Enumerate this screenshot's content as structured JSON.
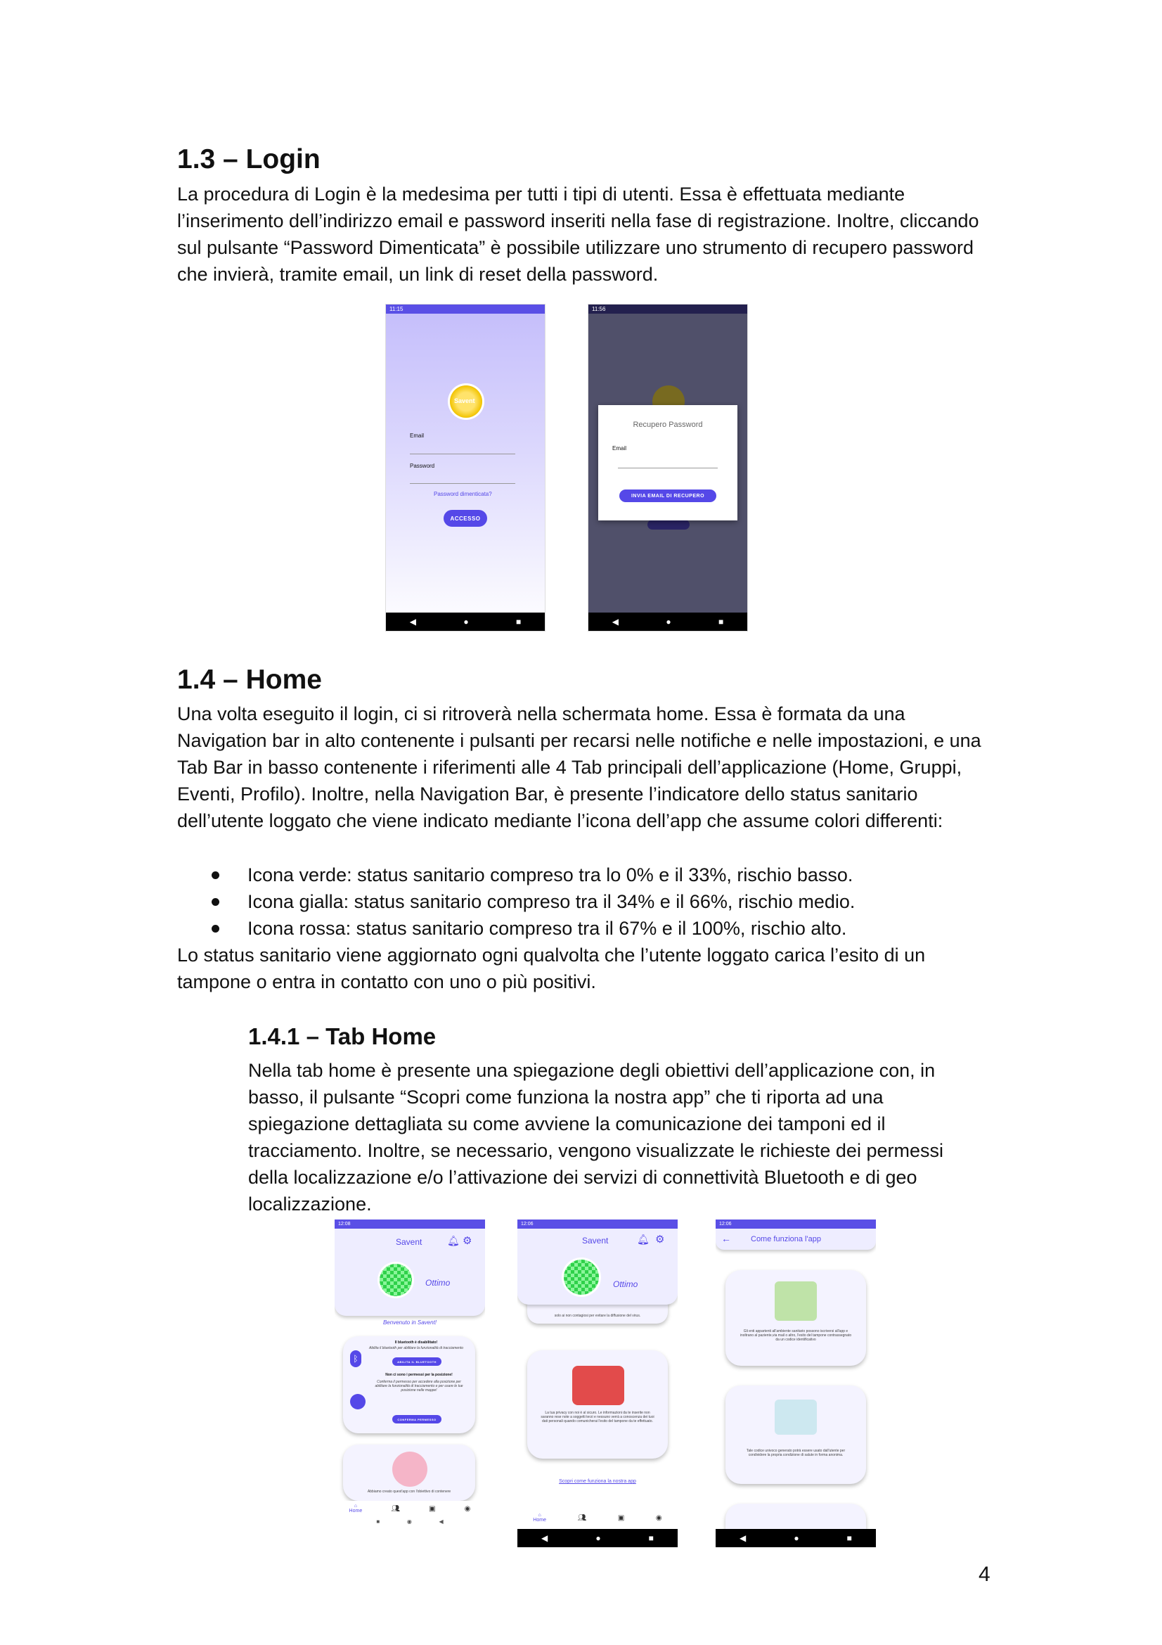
{
  "sec13": {
    "title": "1.3 – Login",
    "text": "La procedura di Login è la medesima per tutti i tipi di utenti. Essa è effettuata mediante l’inserimento dell’indirizzo email e password inseriti nella fase di registrazione. Inoltre, cliccando sul pulsante “Password Dimenticata” è possibile utilizzare uno strumento di recupero password che invierà, tramite email, un link di reset della password."
  },
  "login_screen": {
    "time": "11:15",
    "logo_text": "Savent",
    "email_label": "Email",
    "password_label": "Password",
    "forgot_link": "Password dimenticata?",
    "access_button": "ACCESSO"
  },
  "recovery_screen": {
    "time": "11:56",
    "dialog_title": "Recupero Password",
    "email_label": "Email",
    "send_button": "INVIA EMAIL DI RECUPERO"
  },
  "sec14": {
    "title": "1.4 – Home",
    "text": "Una volta eseguito il login, ci si ritroverà nella schermata home. Essa è formata da una Navigation bar in alto contenente i pulsanti per recarsi nelle notifiche e nelle impostazioni, e una Tab Bar in basso contenente i riferimenti alle 4 Tab principali dell’applicazione (Home, Gruppi, Eventi, Profilo). Inoltre, nella Navigation Bar, è presente l’indicatore dello status sanitario dell’utente loggato che viene indicato mediante l’icona dell’app che assume colori differenti:",
    "bullets": [
      "Icona verde: status sanitario compreso tra lo 0% e il 33%, rischio basso.",
      "Icona gialla: status sanitario compreso tra il 34% e il 66%, rischio medio.",
      "Icona rossa: status sanitario compreso tra il 67% e il 100%, rischio alto."
    ],
    "text2": "Lo status sanitario viene aggiornato ogni qualvolta che l’utente loggato carica l’esito di un tampone o entra in contatto con uno o più positivi."
  },
  "sec141": {
    "title": "1.4.1 – Tab Home",
    "text": "Nella tab home è presente una spiegazione degli obiettivi dell’applicazione con, in basso, il pulsante “Scopri come funziona la nostra app” che ti riporta ad una spiegazione dettagliata su come avviene la comunicazione dei tamponi ed il tracciamento. Inoltre, se necessario, vengono visualizzate le richieste dei permessi della localizzazione e/o l’attivazione dei servizi di connettività Bluetooth e di geo localizzazione."
  },
  "home1": {
    "time": "12:08",
    "app_title": "Savent",
    "status": "Ottimo",
    "welcome": "Benvenuto in Savent!",
    "bt_title": "Il bluetooth è disabilitato!",
    "bt_text": "Abilita il bluetooth per abilitare la funzionalità di tracciamento",
    "bt_button": "ABILITA IL BLUETOOTH",
    "pos_title": "Non ci sono i permessi per la posizione!",
    "pos_text": "Conferma il permesso per accedere alla posizione per abilitare la funzionalità di tracciamento e per usare le tue posizione nelle mappe!",
    "pos_button": "CONFERMA PERMESSO",
    "bottom_text": "Abbiamo creato quest'app con l'obiettivo di contenere",
    "tab_home": "Home"
  },
  "home2": {
    "time": "12:06",
    "app_title": "Savent",
    "status": "Ottimo",
    "top_text": "solo ai non contagiosi per evitare la diffusione del virus.",
    "privacy_text": "La tua privacy con noi è al sicuro. Le informazioni da te inserite non saranno rese note a soggetti terzi e nessuno verrà a conoscenza dei tuoi dati personali quando comunicherai l'esito del tampone da te effettuato.",
    "discover_link": "Scopri come funziona la nostra app",
    "tab_home": "Home"
  },
  "howto": {
    "time": "12:06",
    "title": "Come funziona l'app",
    "card1_text": "Gli enti appartenti all'ambiente sanitario possono iscriversi all'app e inoltrano al paziente,via mail o altro, l'esito del tampone contrassegnato da un codice identificativo",
    "card2_text": "Tale codice univoco generato potrà essere usato dall'utente per condividere la propria condizione di salute in forma anonima."
  },
  "colors": {
    "primary": "#5548e8",
    "lavender": "#c8c3fa",
    "dialog_overlay": "#4f4f66",
    "green_status": "#2fd14a"
  },
  "page_number": "4"
}
